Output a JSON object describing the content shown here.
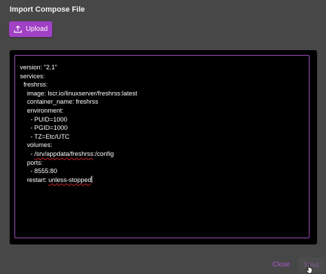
{
  "dialog": {
    "title": "Import Compose File",
    "upload_label": "Upload",
    "close_label": "Close",
    "next_label": "Next"
  },
  "editor": {
    "lines": [
      "version: \"2.1\"",
      "services:",
      "  freshrss:",
      "    image: lscr.io/linuxserver/freshrss:latest",
      "    container_name: freshrss",
      "    environment:",
      "      - PUID=1000",
      "      - PGID=1000",
      "      - TZ=Etc/UTC",
      "    volumes:",
      "      - ",
      "/srv/appdata/freshrss",
      ":/config",
      "    ports:",
      "      - 8555:80",
      "    restart: ",
      "unless-stopped"
    ]
  },
  "colors": {
    "accent": "#a040c4",
    "editor_border": "#a04fbf",
    "background": "#474747"
  },
  "icons": {
    "upload": "upload-icon",
    "cursor": "hand-pointer-icon"
  }
}
